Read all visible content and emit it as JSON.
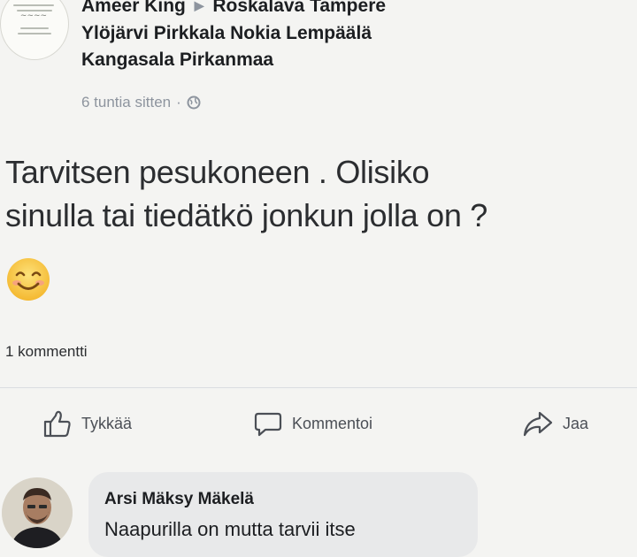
{
  "post": {
    "author": "Ameer King",
    "group_line1": "Roskalava Tampere",
    "group_line2": "Ylöjärvi Pirkkala Nokia Lempäälä",
    "group_line3": "Kangasala Pirkanmaa",
    "time": "6 tuntia sitten",
    "separator": "·",
    "text_line1": "Tarvitsen pesukoneen . Olisiko",
    "text_line2": "sinulla tai tiedätkö jonkun jolla  on ?",
    "emoji": "smiling-face-icon",
    "comment_count": "1 kommentti"
  },
  "actions": {
    "like": "Tykkää",
    "comment": "Kommentoi",
    "share": "Jaa"
  },
  "comment": {
    "author": "Arsi Mäksy Mäkelä",
    "text": "Naapurilla on mutta tarvii itse"
  },
  "colors": {
    "background": "#f4f4f2",
    "meta_text": "#8d949e",
    "bubble": "#e8e9ea",
    "emoji_face": "#f7c842"
  }
}
